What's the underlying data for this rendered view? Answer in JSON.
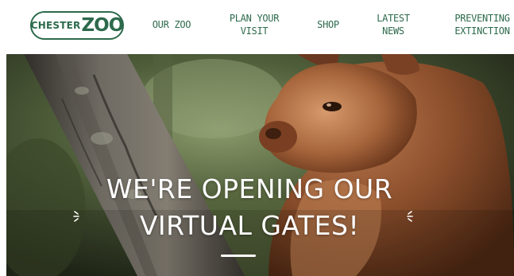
{
  "header": {
    "logo": {
      "chester": "CHESTER",
      "zoo": "ZOO"
    },
    "nav": [
      {
        "lines": [
          "OUR ZOO"
        ]
      },
      {
        "lines": [
          "PLAN YOUR",
          "VISIT"
        ]
      },
      {
        "lines": [
          "SHOP"
        ]
      },
      {
        "lines": [
          "LATEST",
          "NEWS"
        ]
      },
      {
        "lines": [
          "PREVENTING",
          "EXTINCTION"
        ]
      }
    ]
  },
  "hero": {
    "heading_lines": [
      "WE'RE OPENING OUR",
      "VIRTUAL GATES!"
    ],
    "image_subject": "tree-kangaroo-on-branch"
  },
  "colors": {
    "brand_green": "#2d6a4c",
    "hero_text": "#ffffff"
  }
}
